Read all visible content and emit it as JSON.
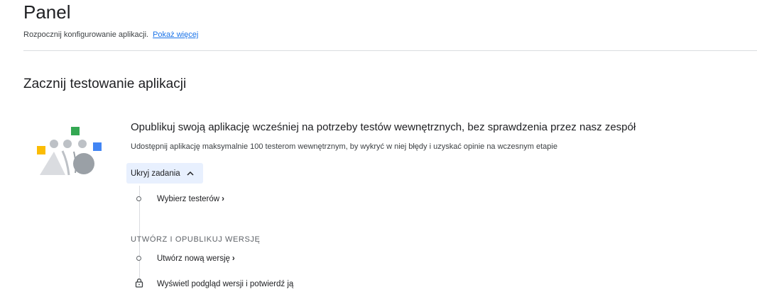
{
  "header": {
    "title": "Panel",
    "subtitle": "Rozpocznij konfigurowanie aplikacji.",
    "show_more": "Pokaż więcej"
  },
  "section": {
    "title": "Zacznij testowanie aplikacji"
  },
  "card": {
    "illustration_icon": "testers-group-illustration",
    "title": "Opublikuj swoją aplikację wcześniej na potrzeby testów wewnętrznych, bez sprawdzenia przez nasz zespół",
    "description": "Udostępnij aplikację maksymalnie 100 testerom wewnętrznym, by wykryć w niej błędy i uzyskać opinie na wczesnym etapie",
    "toggle_label": "Ukryj zadania",
    "toggle_icon": "chevron-up-icon",
    "tasks": [
      {
        "label": "Wybierz testerów",
        "arrow": "›",
        "icon": "circle-icon"
      }
    ],
    "group": {
      "label": "UTWÓRZ I OPUBLIKUJ WERSJĘ",
      "tasks": [
        {
          "label": "Utwórz nową wersję",
          "arrow": "›",
          "icon": "circle-icon"
        },
        {
          "label": "Wyświetl podgląd wersji i potwierdź ją",
          "icon": "lock-icon"
        }
      ]
    }
  },
  "colors": {
    "accent": "#1a73e8",
    "toggle_bg": "#e8f0fe",
    "divider": "#dadce0",
    "illustration_green": "#34a853",
    "illustration_yellow": "#fbbc04",
    "illustration_blue": "#4285f4",
    "illustration_gray": "#bdc1c6"
  }
}
